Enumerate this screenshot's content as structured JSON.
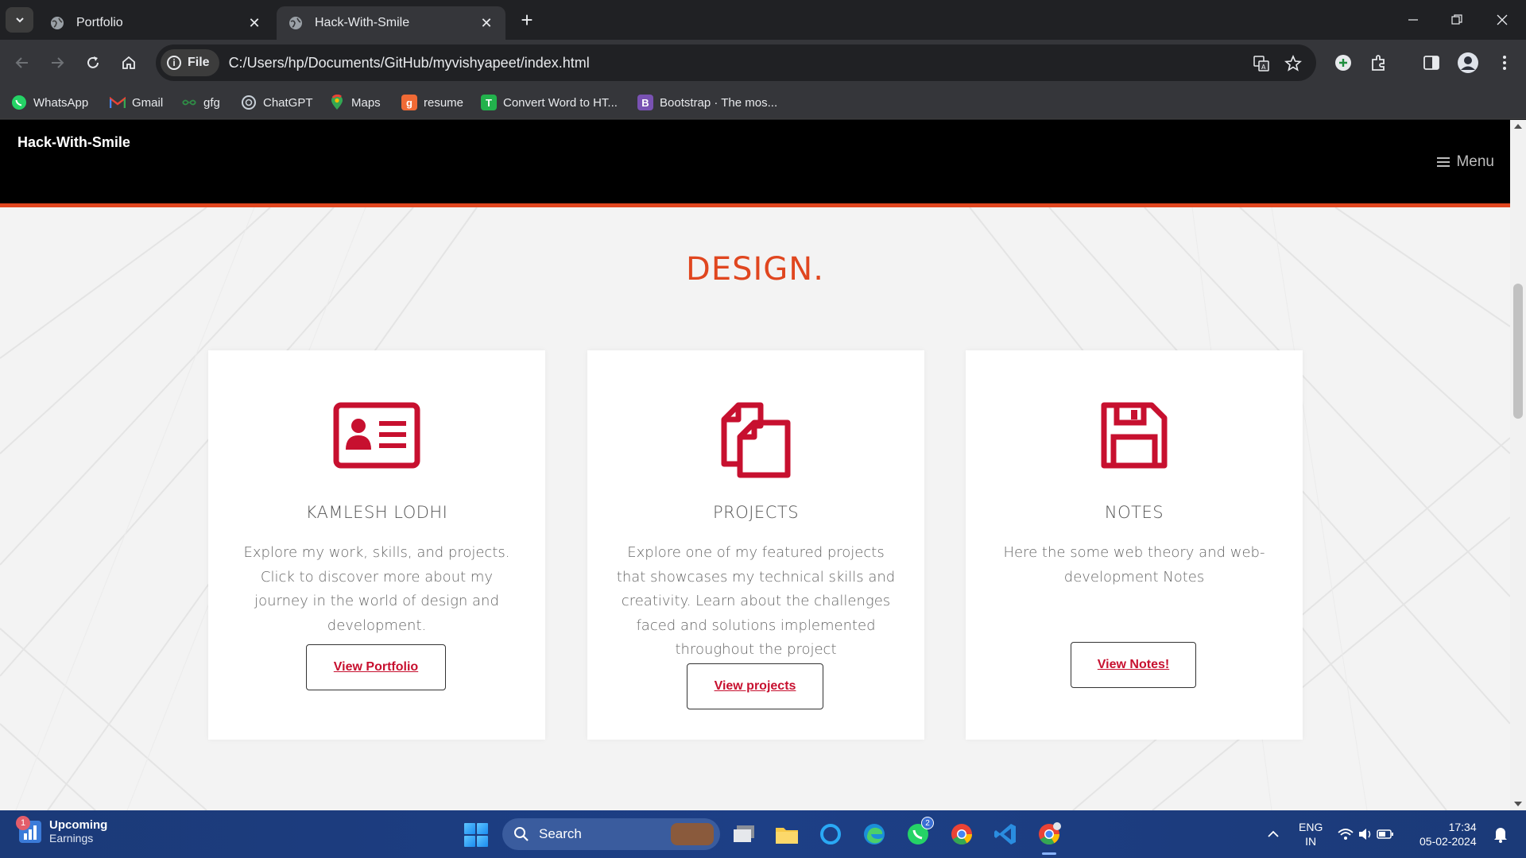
{
  "browser": {
    "tabs": [
      {
        "title": "Portfolio",
        "active": false
      },
      {
        "title": "Hack-With-Smile",
        "active": true
      }
    ],
    "address": {
      "chip_label": "File",
      "url": "C:/Users/hp/Documents/GitHub/myvishyapeet/index.html"
    },
    "bookmarks": [
      {
        "label": "WhatsApp",
        "icon": "whatsapp-icon",
        "color": "#25d366"
      },
      {
        "label": "Gmail",
        "icon": "gmail-icon",
        "color": "#ea4335"
      },
      {
        "label": "gfg",
        "icon": "gfg-icon",
        "color": "#2f8d46"
      },
      {
        "label": "ChatGPT",
        "icon": "chatgpt-icon",
        "color": "#74aa9c"
      },
      {
        "label": "Maps",
        "icon": "maps-icon",
        "color": "#34a853"
      },
      {
        "label": "resume",
        "icon": "resume-icon",
        "color": "#f06a35",
        "glyph": "g"
      },
      {
        "label": "Convert Word to HT...",
        "icon": "convert-icon",
        "color": "#22b24c",
        "glyph": "T"
      },
      {
        "label": "Bootstrap · The mos...",
        "icon": "bootstrap-icon",
        "color": "#7952b3",
        "glyph": "B"
      }
    ]
  },
  "site": {
    "brand": "Hack-With-Smile",
    "menu_label": "Menu",
    "section_title": "DESIGN.",
    "accent_color": "#e0461f",
    "icon_color": "#c7102f",
    "cards": [
      {
        "icon": "id-card-icon",
        "heading": "KAMLESH LODHI",
        "text": "Explore my work, skills, and projects. Click to discover more about my journey in the world of design and development.",
        "button": "View Portfolio"
      },
      {
        "icon": "copy-files-icon",
        "heading": "PROJECTS",
        "text": "Explore one of my featured projects that showcases my technical skills and creativity. Learn about the challenges faced and solutions implemented throughout the project",
        "button": "View projects"
      },
      {
        "icon": "floppy-disk-icon",
        "heading": "NOTES",
        "text": "Here the some web theory and web-development Notes",
        "button": "View Notes!"
      }
    ]
  },
  "taskbar": {
    "weather_badge": "1",
    "weather_title": "Upcoming",
    "weather_subtitle": "Earnings",
    "search_label": "Search",
    "whatsapp_badge": "2",
    "lang_line1": "ENG",
    "lang_line2": "IN",
    "time": "17:34",
    "date": "05-02-2024"
  }
}
